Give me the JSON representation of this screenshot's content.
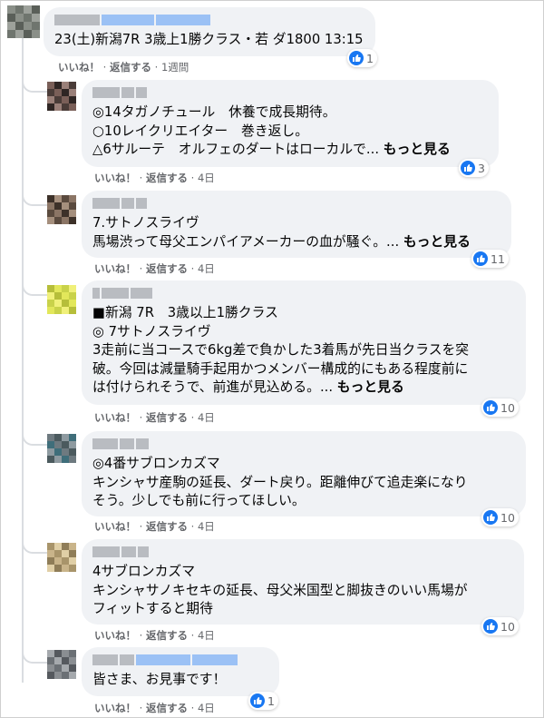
{
  "comments": [
    {
      "text": "23(土)新潟7R 3歳上1勝クラス・若 ダ1800 13:15",
      "more": "",
      "actions": {
        "like": "いいね！",
        "reply": "返信する",
        "time": "1週間"
      },
      "reaction_count": "1",
      "colors": [
        "#8a8f88",
        "#6f756e",
        "#9da19b",
        "#5a5f59"
      ]
    },
    {
      "text": "◎14タガノチュール　休養で成長期待。\n○10レイクリエイター　巻き返し。\n△6サルーテ　オルフェのダートはローカルで... ",
      "more": "もっと見る",
      "actions": {
        "like": "いいね！",
        "reply": "返信する",
        "time": "4日"
      },
      "reaction_count": "3",
      "colors": [
        "#4a3c38",
        "#7a5f58",
        "#2f2624",
        "#9a8079"
      ]
    },
    {
      "text": "7.サトノスライヴ\n馬場渋って母父エンパイアメーカーの血が騒ぐ。... ",
      "more": "もっと見る",
      "actions": {
        "like": "いいね！",
        "reply": "返信する",
        "time": "4日"
      },
      "reaction_count": "11",
      "colors": [
        "#5a4a3e",
        "#8b7565",
        "#3d3129",
        "#a58f7d"
      ]
    },
    {
      "text": "■新潟 7R　3歳以上1勝クラス\n◎ 7サトノスライヴ\n3走前に当コースで6kg差で負かした3着馬が先日当クラスを突\n破。今回は減量騎手起用かつメンバー構成的にもある程度前に\nは付けられそうで、前進が見込める。... ",
      "more": "もっと見る",
      "actions": {
        "like": "いいね！",
        "reply": "返信する",
        "time": "4日"
      },
      "reaction_count": "10",
      "colors": [
        "#e2e75a",
        "#c9d24a",
        "#f0f07a",
        "#b6be3a"
      ]
    },
    {
      "text": "◎4番サブロンカズマ\nキンシャサ産駒の延長、ダート戻り。距離伸びて追走楽になり\nそう。少しでも前に行ってほしい。",
      "more": "",
      "actions": {
        "like": "いいね！",
        "reply": "返信する",
        "time": "4日"
      },
      "reaction_count": "10",
      "colors": [
        "#6e7a80",
        "#4b5a5e",
        "#8e9aa0",
        "#3f6e7a"
      ]
    },
    {
      "text": "4サブロンカズマ\nキンシャサノキセキの延長、母父米国型と脚抜きのいい馬場が\nフィットすると期待",
      "more": "",
      "actions": {
        "like": "いいね！",
        "reply": "返信する",
        "time": "4日"
      },
      "reaction_count": "10",
      "colors": [
        "#c9b48a",
        "#a8946a",
        "#e0cfa6",
        "#8f7d58"
      ]
    },
    {
      "text": "皆さま、お見事です！",
      "more": "",
      "actions": {
        "like": "いいね！",
        "reply": "返信する",
        "time": "4日"
      },
      "reaction_count": "1",
      "colors": [
        "#8a8e92",
        "#6b7075",
        "#a5a9ad",
        "#55595e"
      ]
    }
  ],
  "icons": {
    "like": "thumbs-up-icon"
  },
  "accent_color": "#1877f2"
}
